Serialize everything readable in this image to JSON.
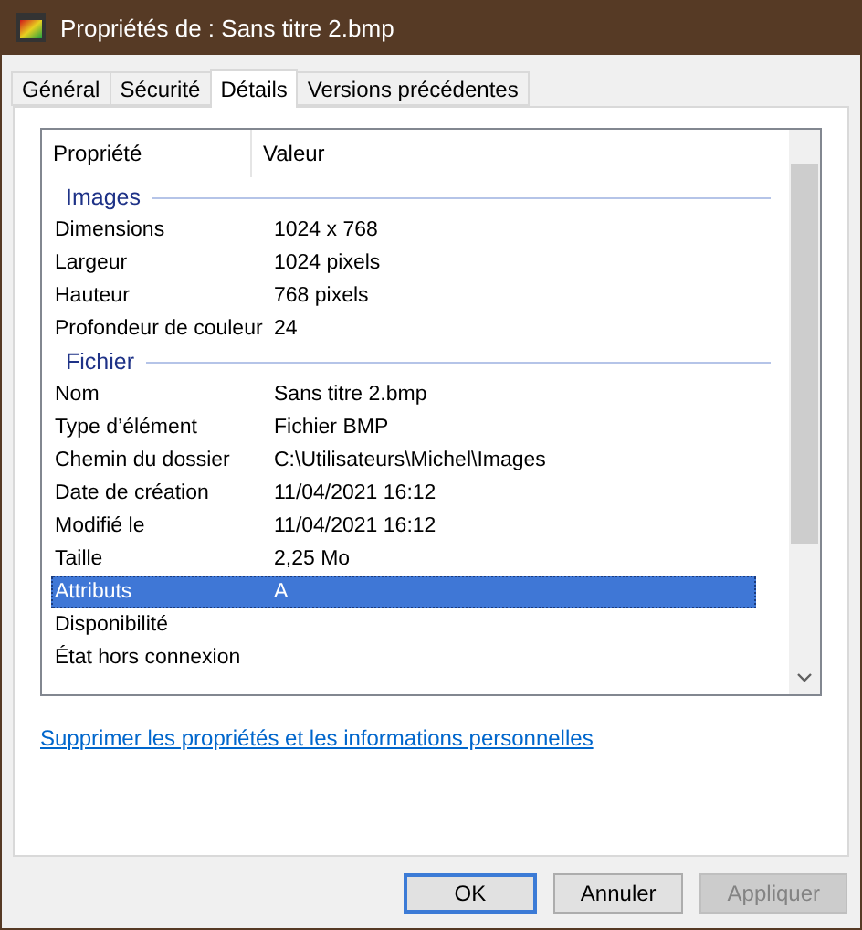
{
  "window": {
    "title": "Propriétés de : Sans titre 2.bmp"
  },
  "tabs": [
    {
      "label": "Général",
      "selected": false
    },
    {
      "label": "Sécurité",
      "selected": false
    },
    {
      "label": "Détails",
      "selected": true
    },
    {
      "label": "Versions précédentes",
      "selected": false
    }
  ],
  "table": {
    "columns": [
      "Propriété",
      "Valeur"
    ],
    "groups": [
      {
        "title": "Images",
        "rows": [
          {
            "name": "Dimensions",
            "value": "1024 x 768",
            "selected": false
          },
          {
            "name": "Largeur",
            "value": "1024 pixels",
            "selected": false
          },
          {
            "name": "Hauteur",
            "value": "768 pixels",
            "selected": false
          },
          {
            "name": "Profondeur de couleur",
            "value": "24",
            "selected": false
          }
        ]
      },
      {
        "title": "Fichier",
        "rows": [
          {
            "name": "Nom",
            "value": "Sans titre 2.bmp",
            "selected": false
          },
          {
            "name": "Type d’élément",
            "value": "Fichier BMP",
            "selected": false
          },
          {
            "name": "Chemin du dossier",
            "value": "C:\\Utilisateurs\\Michel\\Images",
            "selected": false
          },
          {
            "name": "Date de création",
            "value": "11/04/2021 16:12",
            "selected": false
          },
          {
            "name": "Modifié le",
            "value": "11/04/2021 16:12",
            "selected": false
          },
          {
            "name": "Taille",
            "value": "2,25 Mo",
            "selected": false
          },
          {
            "name": "Attributs",
            "value": "A",
            "selected": true
          },
          {
            "name": "Disponibilité",
            "selected": false
          },
          {
            "name": "État hors connexion",
            "selected": false
          }
        ]
      }
    ]
  },
  "link": "Supprimer les propriétés et les informations personnelles",
  "buttons": [
    {
      "label": "OK",
      "kind": "default",
      "disabled": false
    },
    {
      "label": "Annuler",
      "kind": "normal",
      "disabled": false
    },
    {
      "label": "Appliquer",
      "kind": "normal",
      "disabled": true
    }
  ]
}
